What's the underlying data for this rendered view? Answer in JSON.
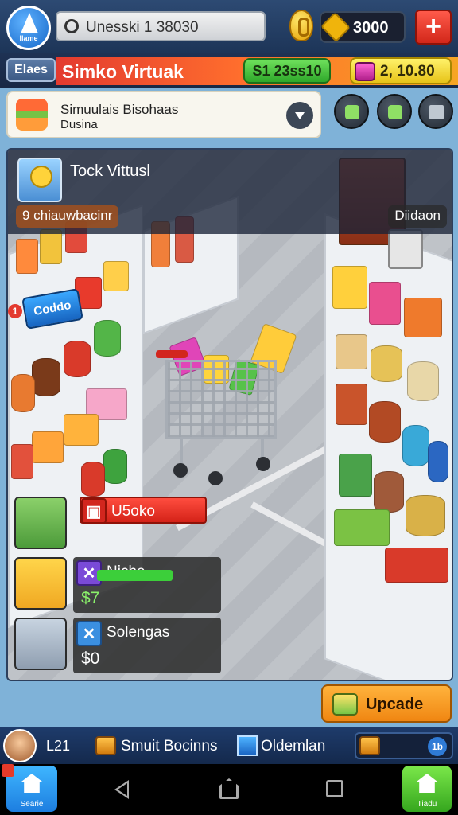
{
  "topbar": {
    "logo_label": "Ilame",
    "search_text": "Unesski 1 38030",
    "money": "3000",
    "plus_label": "+"
  },
  "titlebar": {
    "back_label": "Elaes",
    "title": "Simko Virtuak",
    "stat_green": "S1 23ss10",
    "stat_yellow": "2, 10.80"
  },
  "info_card": {
    "line1": "Simuulais Bisohaas",
    "line2": "Dusina"
  },
  "panel": {
    "player_name": "Tock Vittusl",
    "chip_left": "9 chiauwbacinr",
    "chip_right": "Diidaon",
    "left_sign": "Coddo",
    "left_badge": "1"
  },
  "tasks": [
    {
      "label": "U5oko",
      "value": "",
      "icon": "block-icon"
    },
    {
      "label": "Niche",
      "value": "$7",
      "icon": "x-icon",
      "progress": 0.45
    },
    {
      "label": "Solengas",
      "value": "$0",
      "icon": "x-icon"
    }
  ],
  "upgrade": {
    "label": "Upcade"
  },
  "bottom_strip": {
    "level": "L21",
    "item1": "Smuit Bocinns",
    "item2": "Oldemlan",
    "pill_badge": "1b"
  },
  "nav": {
    "left_app_label": "Searie",
    "right_app_label": "Tiadu"
  },
  "colors": {
    "accent_red": "#e33a2f",
    "accent_orange": "#f08612",
    "accent_green": "#3ccf3a",
    "topbar": "#2d4a73"
  }
}
